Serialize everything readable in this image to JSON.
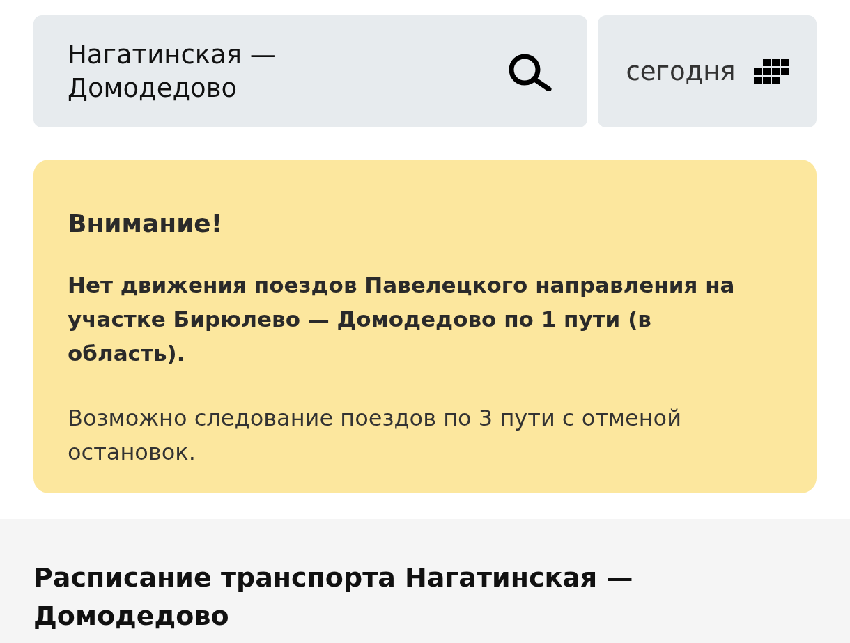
{
  "search": {
    "value": "Нагатинская — Домодедово"
  },
  "date_button": {
    "label": "сегодня"
  },
  "alert": {
    "title": "Внимание!",
    "message": "Нет движения поездов Павелецкого направления на участке Бирюлево — Домодедово по 1 пути (в область).",
    "note": "Возможно следование поездов по 3 пути с отменой остановок."
  },
  "section": {
    "heading": "Расписание транспорта Нагатинская — Домодедово"
  }
}
